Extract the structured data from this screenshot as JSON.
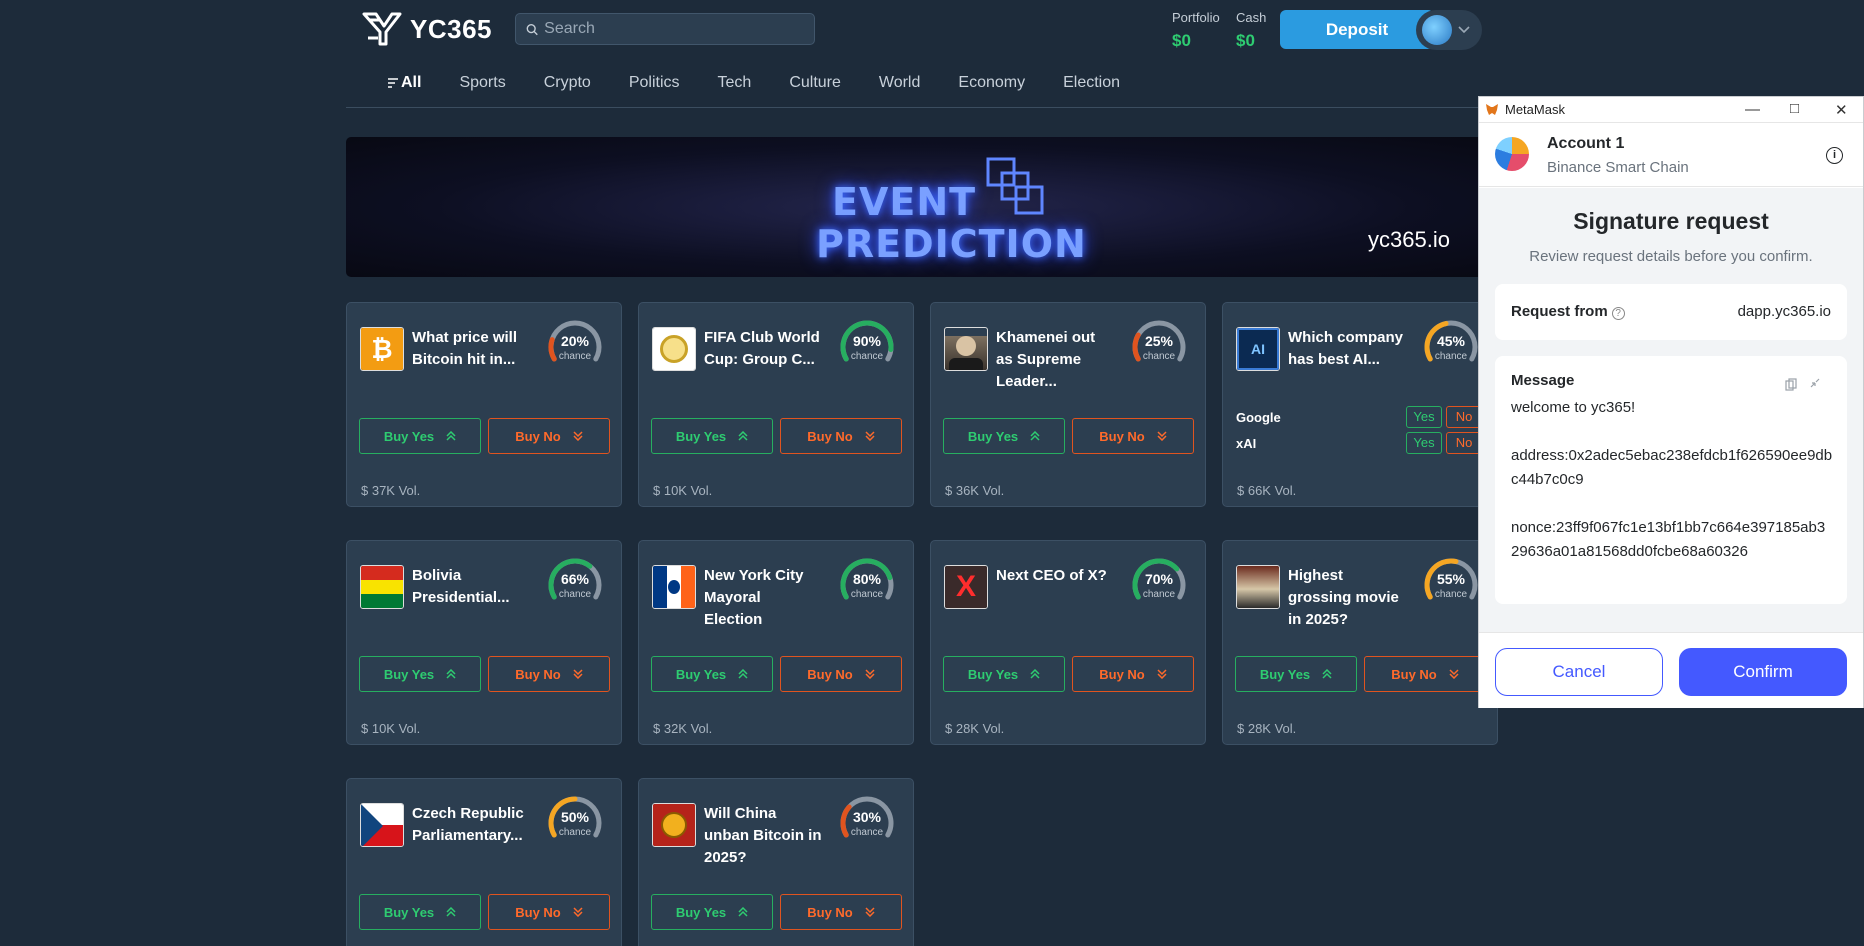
{
  "header": {
    "brand": "YC365",
    "search_placeholder": "Search",
    "portfolio_label": "Portfolio",
    "portfolio_value": "$0",
    "cash_label": "Cash",
    "cash_value": "$0",
    "deposit_label": "Deposit"
  },
  "nav": {
    "items": [
      "All",
      "Sports",
      "Crypto",
      "Politics",
      "Tech",
      "Culture",
      "World",
      "Economy",
      "Election"
    ],
    "active": "All"
  },
  "banner": {
    "line1": "EVENT",
    "line2": "PREDICTION",
    "url": "yc365.io"
  },
  "card_labels": {
    "chance": "chance",
    "buy_yes": "Buy Yes",
    "buy_no": "Buy No"
  },
  "markets": [
    {
      "title": "What price will Bitcoin hit in...",
      "chance_pct": 20,
      "chance_text": "20%",
      "volume": "$ 37K Vol.",
      "gauge_color": "#e0541f",
      "image_icon": "bitcoin-icon"
    },
    {
      "title": "FIFA Club World Cup: Group C...",
      "chance_pct": 90,
      "chance_text": "90%",
      "volume": "$ 10K Vol.",
      "gauge_color": "#27ae60",
      "image_icon": "fifa-trophy-icon"
    },
    {
      "title": "Khamenei out as Supreme Leader...",
      "chance_pct": 25,
      "chance_text": "25%",
      "volume": "$ 36K Vol.",
      "gauge_color": "#e0541f",
      "image_icon": "khamenei-photo"
    },
    {
      "title": "Which company has best AI...",
      "chance_pct": 45,
      "chance_text": "45%",
      "volume": "$ 66K Vol.",
      "gauge_color": "#f5a623",
      "image_icon": "ai-chip-icon",
      "options": [
        {
          "name": "Google",
          "yes": "Yes",
          "no": "No"
        },
        {
          "name": "xAI",
          "yes": "Yes",
          "no": "No"
        }
      ]
    },
    {
      "title": "Bolivia Presidential...",
      "chance_pct": 66,
      "chance_text": "66%",
      "volume": "$ 10K Vol.",
      "gauge_color": "#27ae60",
      "image_icon": "bolivia-flag"
    },
    {
      "title": "New York City Mayoral Election",
      "chance_pct": 80,
      "chance_text": "80%",
      "volume": "$ 32K Vol.",
      "gauge_color": "#27ae60",
      "image_icon": "nyc-flag"
    },
    {
      "title": "Next CEO of X?",
      "chance_pct": 70,
      "chance_text": "70%",
      "volume": "$ 28K Vol.",
      "gauge_color": "#27ae60",
      "image_icon": "x-logo"
    },
    {
      "title": "Highest grossing movie in 2025?",
      "chance_pct": 55,
      "chance_text": "55%",
      "volume": "$ 28K Vol.",
      "gauge_color": "#f5a623",
      "image_icon": "box-office-photo"
    },
    {
      "title": "Czech Republic Parliamentary...",
      "chance_pct": 50,
      "chance_text": "50%",
      "volume": "",
      "gauge_color": "#f5a623",
      "image_icon": "czech-flag"
    },
    {
      "title": "Will China unban Bitcoin in 2025?",
      "chance_pct": 30,
      "chance_text": "30%",
      "volume": "",
      "gauge_color": "#e0541f",
      "image_icon": "china-bitcoin-photo"
    }
  ],
  "metamask": {
    "window_title": "MetaMask",
    "account_name": "Account 1",
    "network": "Binance Smart Chain",
    "heading": "Signature request",
    "subheading": "Review request details before you confirm.",
    "request_from_label": "Request from",
    "request_from_value": "dapp.yc365.io",
    "message_label": "Message",
    "message_line1": "welcome to yc365!",
    "message_address": "address:0x2adec5ebac238efdcb1f626590ee9dbc44b7c0c9",
    "message_nonce": "nonce:23ff9f067fc1e13bf1bb7c664e397185ab329636a01a81568dd0fcbe68a60326",
    "cancel_label": "Cancel",
    "confirm_label": "Confirm"
  }
}
